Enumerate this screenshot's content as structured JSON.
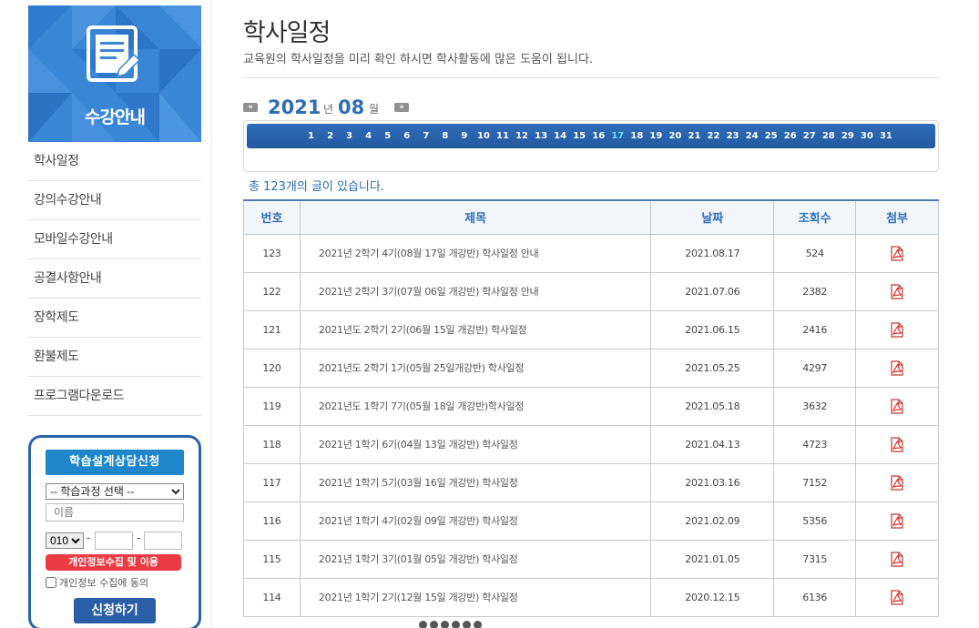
{
  "sidebar": {
    "banner_title": "수강안내",
    "menu": [
      {
        "label": "학사일정"
      },
      {
        "label": "강의수강안내"
      },
      {
        "label": "모바일수강안내"
      },
      {
        "label": "공결사항안내"
      },
      {
        "label": "장학제도"
      },
      {
        "label": "환불제도"
      },
      {
        "label": "프로그램다운로드"
      }
    ],
    "consult": {
      "title": "학습설계상담신청",
      "course_select": "-- 학습과정 선택 --",
      "name_placeholder": "이름",
      "phone_prefix": "010",
      "phone_dash": "-",
      "privacy_button": "개인정보수집 및 이용",
      "agree_label": "개인정보 수집에 동의",
      "submit_button": "신청하기"
    }
  },
  "main": {
    "title": "학사일정",
    "description": "교육원의 학사일정을 미리 확인 하시면 학사활동에 많은 도움이 됩니다.",
    "nav": {
      "prev": "«",
      "next": "»",
      "year": "2021",
      "year_unit": "년",
      "month": "08",
      "month_unit": "월"
    },
    "days": [
      "1",
      "2",
      "3",
      "4",
      "5",
      "6",
      "7",
      "8",
      "9",
      "10",
      "11",
      "12",
      "13",
      "14",
      "15",
      "16",
      "17",
      "18",
      "19",
      "20",
      "21",
      "22",
      "23",
      "24",
      "25",
      "26",
      "27",
      "28",
      "29",
      "30",
      "31"
    ],
    "today": "17",
    "count_text": "총 123개의 글이 있습니다.",
    "table": {
      "headers": [
        "번호",
        "제목",
        "날짜",
        "조회수",
        "첨부"
      ],
      "rows": [
        {
          "no": "123",
          "title": "2021년 2학기 4기(08월 17일 개강반) 학사일정 안내",
          "date": "2021.08.17",
          "views": "524"
        },
        {
          "no": "122",
          "title": "2021년 2학기 3기(07월 06일 개강반) 학사일정 안내",
          "date": "2021.07.06",
          "views": "2382"
        },
        {
          "no": "121",
          "title": "2021년도 2학기 2기(06월 15일 개강반) 학사일정",
          "date": "2021.06.15",
          "views": "2416"
        },
        {
          "no": "120",
          "title": "2021년도 2학기 1기(05월 25일개강반) 학사일정",
          "date": "2021.05.25",
          "views": "4297"
        },
        {
          "no": "119",
          "title": "2021년도 1학기 7기(05월 18일 개강반)학사일정",
          "date": "2021.05.18",
          "views": "3632"
        },
        {
          "no": "118",
          "title": "2021년 1학기 6기(04월 13일 개강반) 학사일정",
          "date": "2021.04.13",
          "views": "4723"
        },
        {
          "no": "117",
          "title": "2021년 1학기 5기(03월 16일 개강반) 학사일정",
          "date": "2021.03.16",
          "views": "7152"
        },
        {
          "no": "116",
          "title": "2021년 1학기 4기(02월 09일 개강반) 학사일정",
          "date": "2021.02.09",
          "views": "5356"
        },
        {
          "no": "115",
          "title": "2021년 1학기 3기(01월 05일 개강반) 학사일정",
          "date": "2021.01.05",
          "views": "7315"
        },
        {
          "no": "114",
          "title": "2021년 1학기 2기(12월 15일 개강반) 학사일정",
          "date": "2020.12.15",
          "views": "6136"
        }
      ]
    }
  },
  "colors": {
    "accent_blue": "#2f6eb6",
    "submit_blue": "#2b5ea8",
    "consult_head": "#1f86cc",
    "privacy_red": "#ec3b43",
    "today_cyan": "#62e0ff"
  }
}
